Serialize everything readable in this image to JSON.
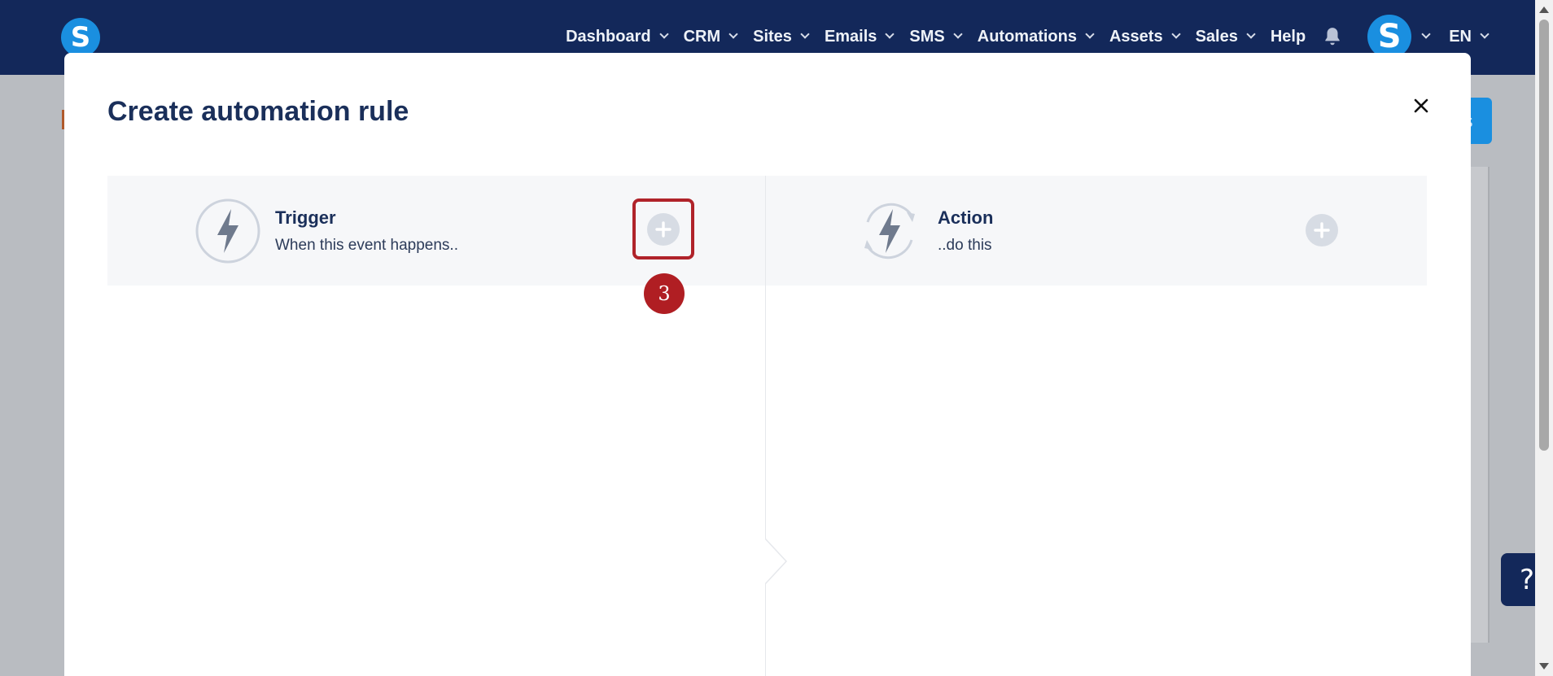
{
  "nav": {
    "logo_letter": "S",
    "items": [
      {
        "label": "Dashboard"
      },
      {
        "label": "CRM"
      },
      {
        "label": "Sites"
      },
      {
        "label": "Emails"
      },
      {
        "label": "SMS"
      },
      {
        "label": "Automations"
      },
      {
        "label": "Assets"
      },
      {
        "label": "Sales"
      }
    ],
    "help_label": "Help",
    "avatar_letter": "S",
    "language": "EN"
  },
  "modal": {
    "title": "Create automation rule",
    "trigger": {
      "title": "Trigger",
      "subtitle": "When this event happens.."
    },
    "action": {
      "title": "Action",
      "subtitle": "..do this"
    }
  },
  "annotation": {
    "step_number": "3"
  },
  "help_widget": {
    "label": "?"
  },
  "colors": {
    "nav_bg": "#13285a",
    "brand_blue": "#1a8fe0",
    "title_text": "#1a2f5a",
    "highlight_red": "#b0232a"
  }
}
